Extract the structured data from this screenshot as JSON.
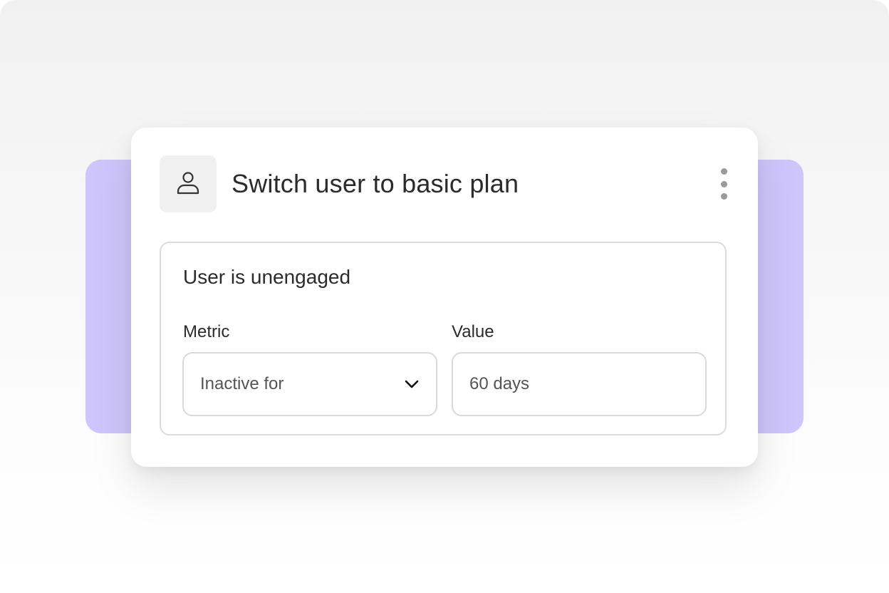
{
  "card": {
    "title": "Switch user to basic plan",
    "avatar_icon": "user-icon",
    "menu_icon": "more-vertical-icon"
  },
  "condition": {
    "title": "User is unengaged",
    "metric": {
      "label": "Metric",
      "value": "Inactive for",
      "icon": "chevron-down-icon"
    },
    "value_field": {
      "label": "Value",
      "value": "60 days"
    }
  },
  "colors": {
    "backdrop": "#cdc5fb",
    "card": "#ffffff",
    "text": "#2b2b2b",
    "muted_text": "#555555",
    "border": "#dcdcdc"
  }
}
